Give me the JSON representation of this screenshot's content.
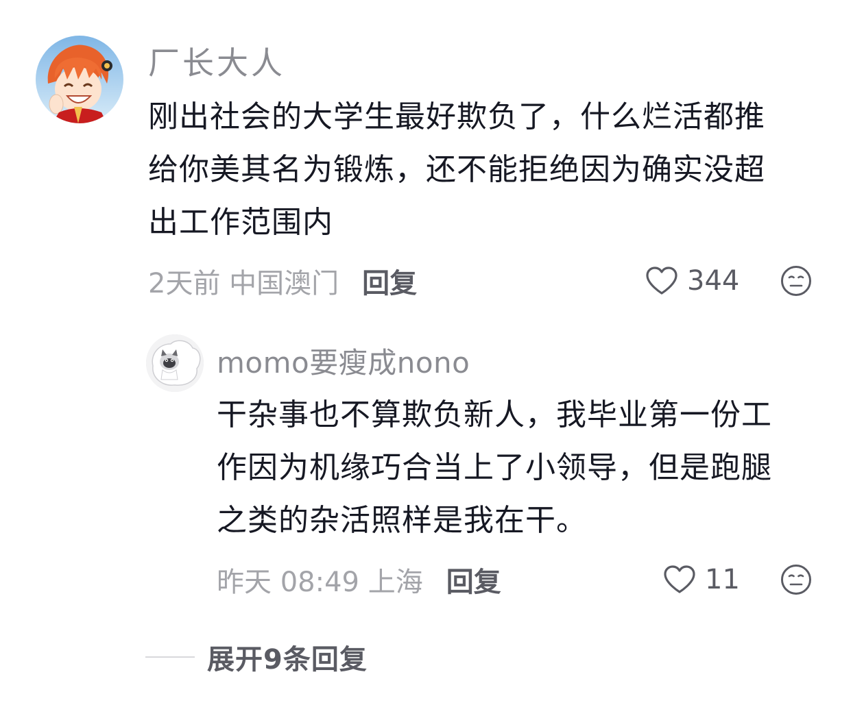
{
  "comment": {
    "username": "厂长大人",
    "lines": [
      "刚出社会的大学生最好欺负了，什么烂活都推",
      "给你美其名为锻炼，还不能拒绝因为确实没超",
      "出工作范围内"
    ],
    "time_location": "2天前 中国澳门",
    "reply_label": "回复",
    "like_count": "344",
    "avatar_icon": "anime-character-avatar"
  },
  "reply": {
    "username": "momo要瘦成nono",
    "lines": [
      "干杂事也不算欺负新人，我毕业第一份工",
      "作因为机缘巧合当上了小领导，但是跑腿",
      "之类的杂活照样是我在干。"
    ],
    "time_location": "昨天 08:49 上海",
    "reply_label": "回复",
    "like_count": "11",
    "avatar_icon": "cat-avatar"
  },
  "expand": {
    "label": "展开9条回复"
  },
  "icons": {
    "like": "heart-outline-icon",
    "dislike": "meh-face-icon"
  },
  "colors": {
    "primary_text": "#161823",
    "secondary_text": "#8a8b91",
    "meta_text": "#a3a4a9",
    "action_text": "#5a5b63"
  }
}
